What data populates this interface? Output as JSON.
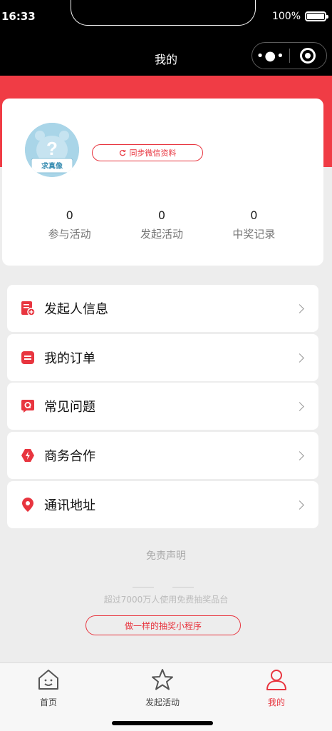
{
  "status_bar": {
    "time": "16:33",
    "battery": "100%"
  },
  "nav": {
    "title": "我的",
    "more_glyph": "•●•"
  },
  "profile": {
    "avatar_text": "求真像",
    "sync_label": "同步微信资料",
    "stats": [
      {
        "value": "0",
        "label": "参与活动"
      },
      {
        "value": "0",
        "label": "发起活动"
      },
      {
        "value": "0",
        "label": "中奖记录"
      }
    ]
  },
  "menu": [
    {
      "label": "发起人信息",
      "icon": "document-plus-icon"
    },
    {
      "label": "我的订单",
      "icon": "order-list-icon"
    },
    {
      "label": "常见问题",
      "icon": "question-bubble-icon"
    },
    {
      "label": "商务合作",
      "icon": "lightning-icon"
    },
    {
      "label": "通讯地址",
      "icon": "location-pin-icon"
    }
  ],
  "footer": {
    "disclaimer": "免责声明",
    "users_text": "超过7000万人使用免费抽奖品台",
    "make_label": "做一样的抽奖小程序"
  },
  "tabbar": [
    {
      "label": "首页",
      "icon": "home-icon",
      "active": false
    },
    {
      "label": "发起活动",
      "icon": "star-icon",
      "active": false
    },
    {
      "label": "我的",
      "icon": "user-icon",
      "active": true
    }
  ],
  "colors": {
    "accent": "#e8353f",
    "band": "#f03c45",
    "background": "#ededed"
  }
}
